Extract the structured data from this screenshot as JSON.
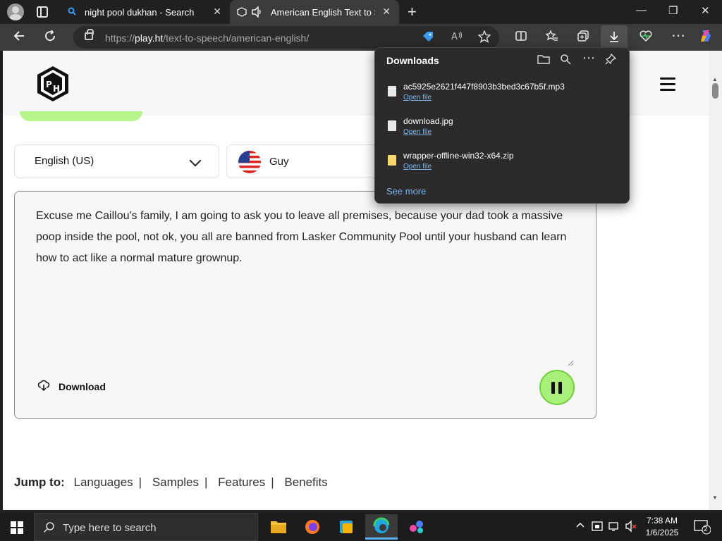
{
  "browser": {
    "tabs": [
      {
        "title": "night pool dukhan - Search",
        "close": "✕"
      },
      {
        "title": "American English Text to Speech",
        "close": "✕"
      }
    ],
    "new_tab": "+",
    "window_controls": {
      "minimize": "—",
      "maximize": "❐",
      "close": "✕"
    },
    "url_prefix": "https://",
    "url_domain": "play.ht",
    "url_path": "/text-to-speech/american-english/"
  },
  "page": {
    "language_select": {
      "value": "English (US)"
    },
    "voice_select": {
      "value": "Guy"
    },
    "editor_text": "Excuse me Caillou's family, I am going to ask you to leave all premises, because your dad took a massive poop inside the pool, not ok, you all are banned from Lasker Community Pool until your husband can learn how to act like a normal mature grownup.",
    "download_label": "Download",
    "jump_to": {
      "label": "Jump to:",
      "links": [
        "Languages",
        "Samples",
        "Features",
        "Benefits"
      ],
      "separator": "|"
    }
  },
  "downloads_panel": {
    "title": "Downloads",
    "items": [
      {
        "name": "ac5925e2621f447f8903b3bed3c67b5f.mp3",
        "action": "Open file",
        "type": "audio"
      },
      {
        "name": "download.jpg",
        "action": "Open file",
        "type": "image"
      },
      {
        "name": "wrapper-offline-win32-x64.zip",
        "action": "Open file",
        "type": "zip"
      }
    ],
    "see_more": "See more"
  },
  "taskbar": {
    "search_placeholder": "Type here to search",
    "time": "7:38 AM",
    "date": "1/6/2025",
    "notification_count": "2"
  },
  "colors": {
    "accent_green": "#a8f07a",
    "link_blue": "#7fb8f0",
    "taskbar_active": "#5ab3ff"
  }
}
